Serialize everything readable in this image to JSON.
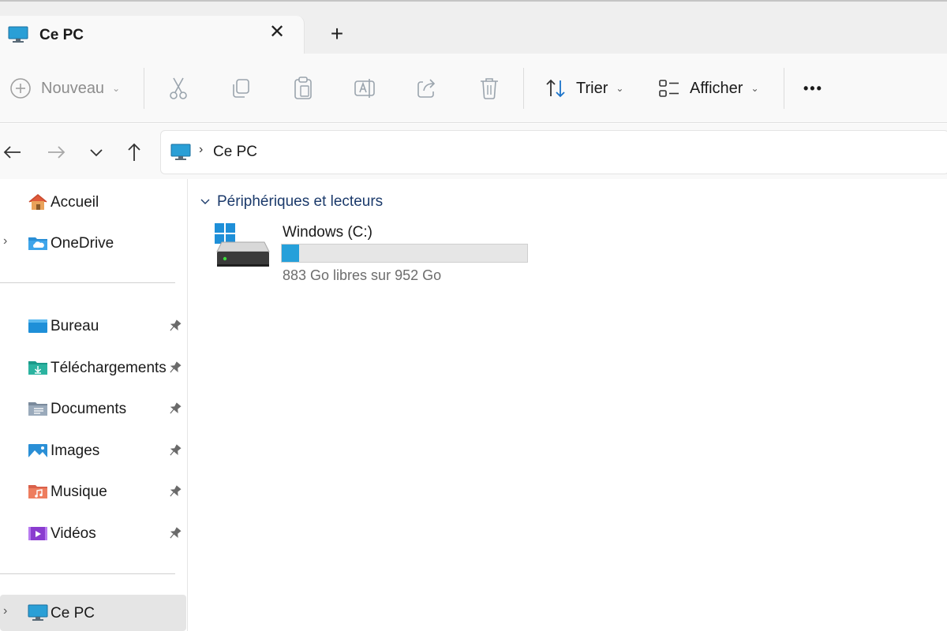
{
  "tab": {
    "title": "Ce PC",
    "icon": "computer-icon",
    "close_icon": "close-icon",
    "new_tab_symbol": "+"
  },
  "toolbar": {
    "new_label": "Nouveau",
    "sort_label": "Trier",
    "view_label": "Afficher",
    "more_symbol": "•••",
    "icons": [
      "add-circle-icon",
      "cut-icon",
      "copy-icon",
      "paste-icon",
      "rename-icon",
      "share-icon",
      "delete-icon",
      "sort-icon",
      "view-icon",
      "more-icon"
    ]
  },
  "navigation": {
    "icons": [
      "back-arrow-icon",
      "forward-arrow-icon",
      "recent-chevron-icon",
      "up-arrow-icon"
    ]
  },
  "address": {
    "path": [
      "Ce PC"
    ],
    "icon": "computer-icon"
  },
  "sidebar": {
    "top_items": [
      {
        "label": "Accueil",
        "icon": "home-icon",
        "expandable": false
      },
      {
        "label": "OneDrive",
        "icon": "onedrive-folder-icon",
        "expandable": true
      }
    ],
    "quick_access": [
      {
        "label": "Bureau",
        "icon": "desktop-folder-icon",
        "pinned": true
      },
      {
        "label": "Téléchargements",
        "icon": "downloads-folder-icon",
        "pinned": true
      },
      {
        "label": "Documents",
        "icon": "documents-folder-icon",
        "pinned": true
      },
      {
        "label": "Images",
        "icon": "pictures-folder-icon",
        "pinned": true
      },
      {
        "label": "Musique",
        "icon": "music-folder-icon",
        "pinned": true
      },
      {
        "label": "Vidéos",
        "icon": "videos-folder-icon",
        "pinned": true
      }
    ],
    "bottom_items": [
      {
        "label": "Ce PC",
        "icon": "computer-icon",
        "expandable": true,
        "selected": true
      }
    ]
  },
  "content": {
    "group_title": "Périphériques et lecteurs",
    "drives": [
      {
        "name": "Windows (C:)",
        "space_text": "883 Go libres sur 952 Go",
        "free_go": 883,
        "total_go": 952,
        "used_fraction": 0.07,
        "icon": "windows-drive-icon"
      }
    ]
  },
  "colors": {
    "accent": "#26a0da",
    "group_title": "#1b3a6b",
    "selection": "#e5e5e5"
  }
}
